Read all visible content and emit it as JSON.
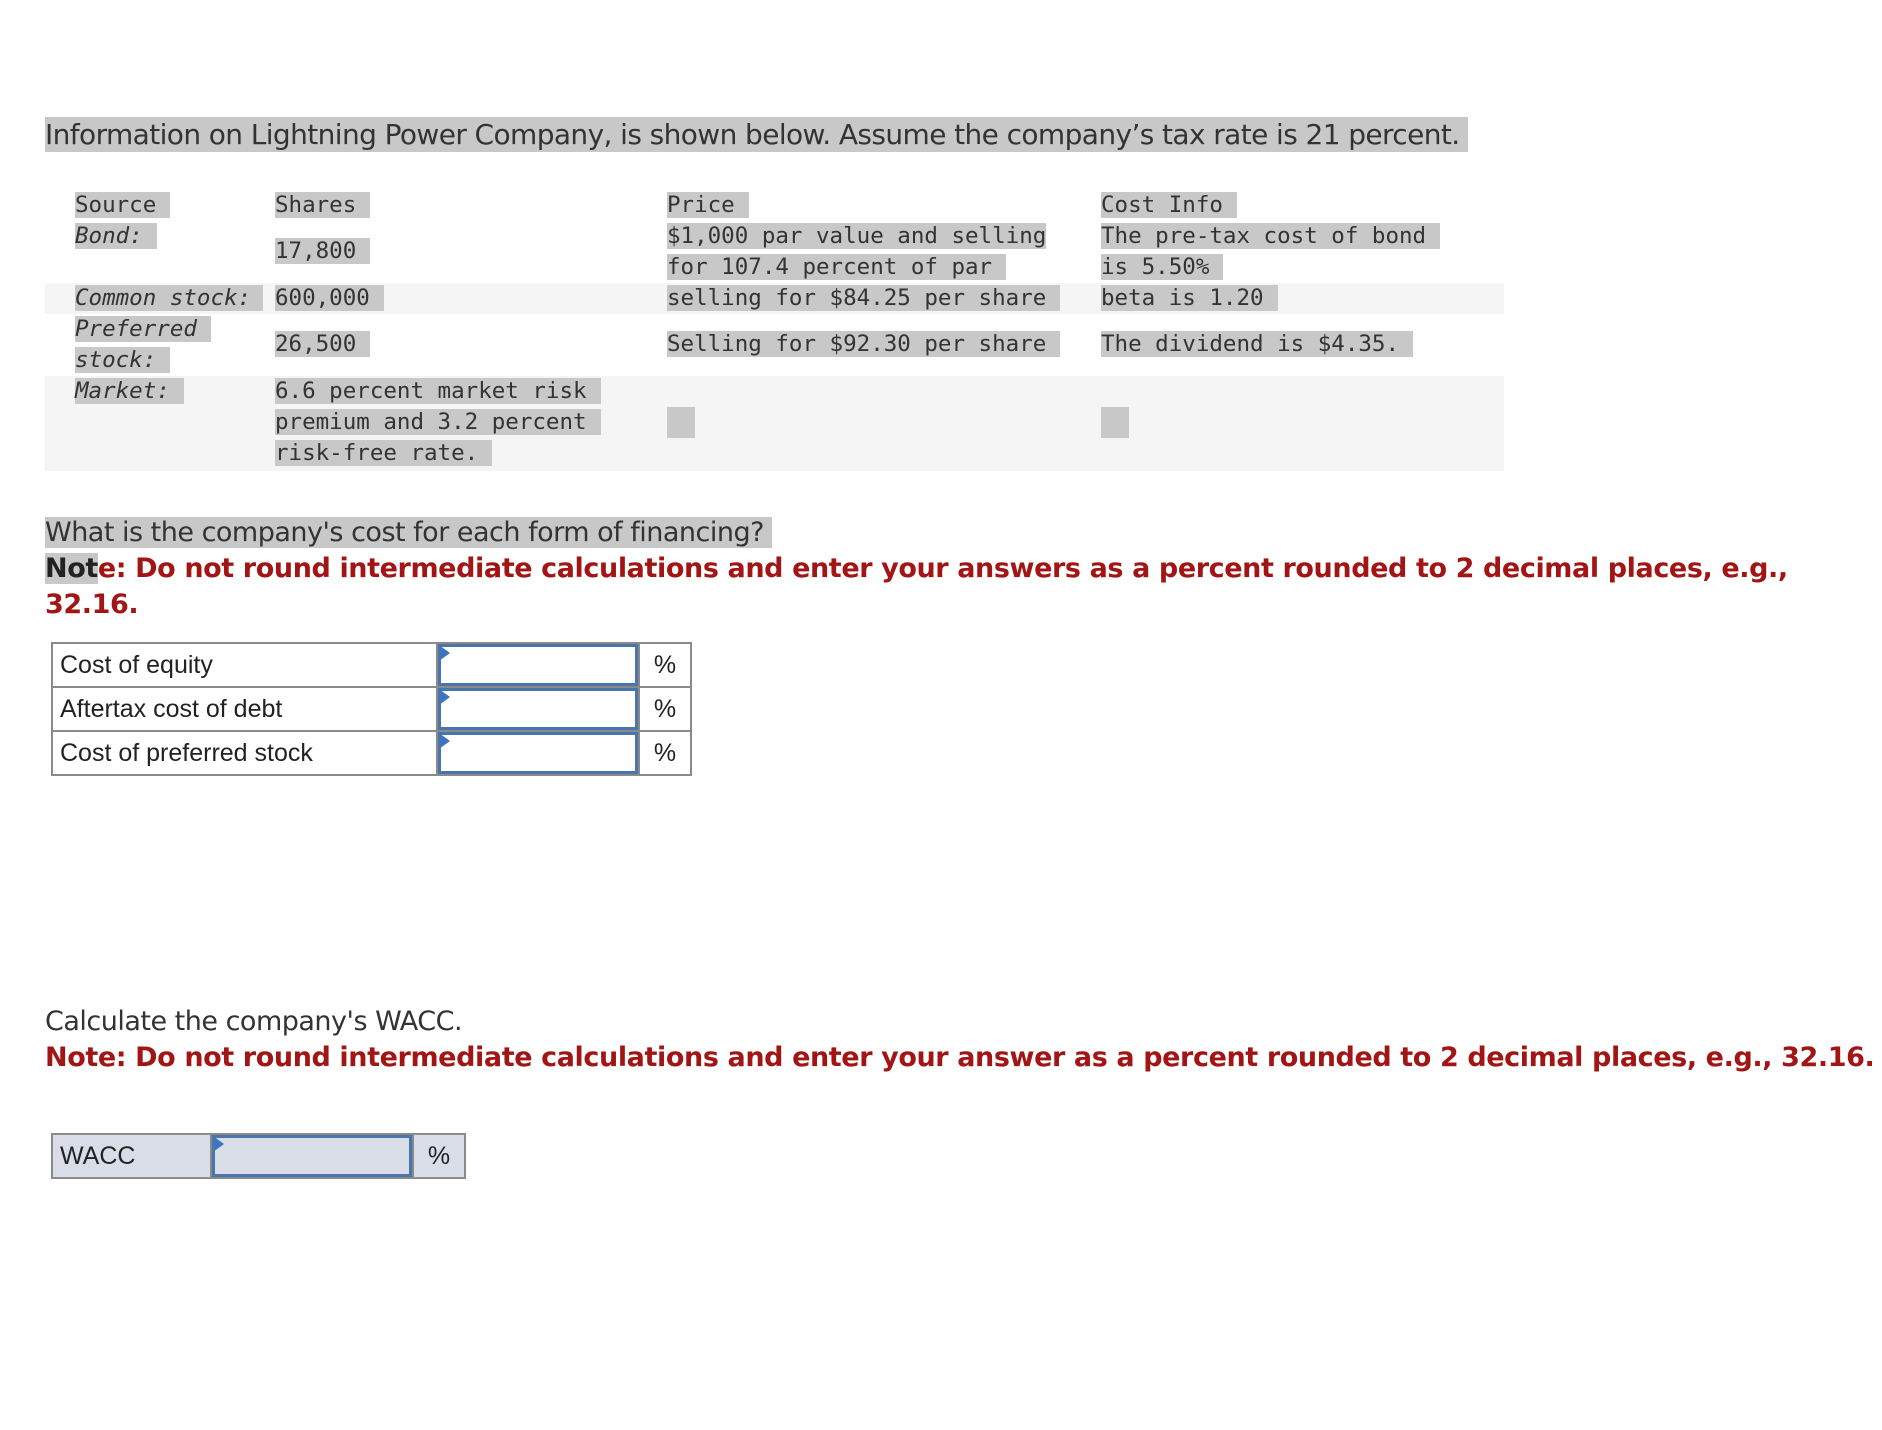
{
  "intro": "Information on Lightning Power Company, is shown below. Assume the company’s tax rate is 21 percent.",
  "info_table": {
    "headers": {
      "source": "Source",
      "shares": "Shares",
      "price": "Price",
      "cost_info": "Cost Info"
    },
    "rows": [
      {
        "source": "Bond:",
        "shares": "17,800",
        "price_lines": [
          "$1,000 par value and selling",
          "for 107.4 percent of par"
        ],
        "cost_lines": [
          "The pre-tax cost of bond",
          "is 5.50%"
        ]
      },
      {
        "source": "Common stock:",
        "shares": "600,000",
        "price_lines": [
          "selling for $84.25 per share"
        ],
        "cost_lines": [
          "beta is 1.20"
        ]
      },
      {
        "source_lines": [
          "Preferred",
          "stock:"
        ],
        "shares": "26,500",
        "price_lines": [
          "Selling for $92.30 per share"
        ],
        "cost_lines": [
          "The dividend is $4.35."
        ]
      },
      {
        "source": "Market:",
        "shares_lines": [
          "6.6 percent market risk",
          "premium and 3.2 percent",
          "risk-free rate."
        ],
        "price_lines": [
          ""
        ],
        "cost_lines": [
          ""
        ]
      }
    ]
  },
  "question1": {
    "text": "What is the company's cost for each form of financing?",
    "note_prefix": "Not",
    "note_rest": "e: Do not round intermediate calculations and enter your answers as a percent rounded to 2 decimal places, e.g., 32.16."
  },
  "answers": [
    {
      "label": "Cost of equity",
      "value": "",
      "unit": "%"
    },
    {
      "label": "Aftertax cost of debt",
      "value": "",
      "unit": "%"
    },
    {
      "label": "Cost of preferred stock",
      "value": "",
      "unit": "%"
    }
  ],
  "question2": {
    "text": "Calculate the company's WACC.",
    "note": "Note: Do not round intermediate calculations and enter your answer as a percent rounded to 2 decimal places, e.g., 32.16."
  },
  "wacc": {
    "label": "WACC",
    "value": "",
    "unit": "%"
  },
  "colors": {
    "note_red": "#a31515",
    "input_border": "#4a74ad",
    "highlight": "#c8c8c8",
    "wacc_bg": "#d8dde8"
  }
}
